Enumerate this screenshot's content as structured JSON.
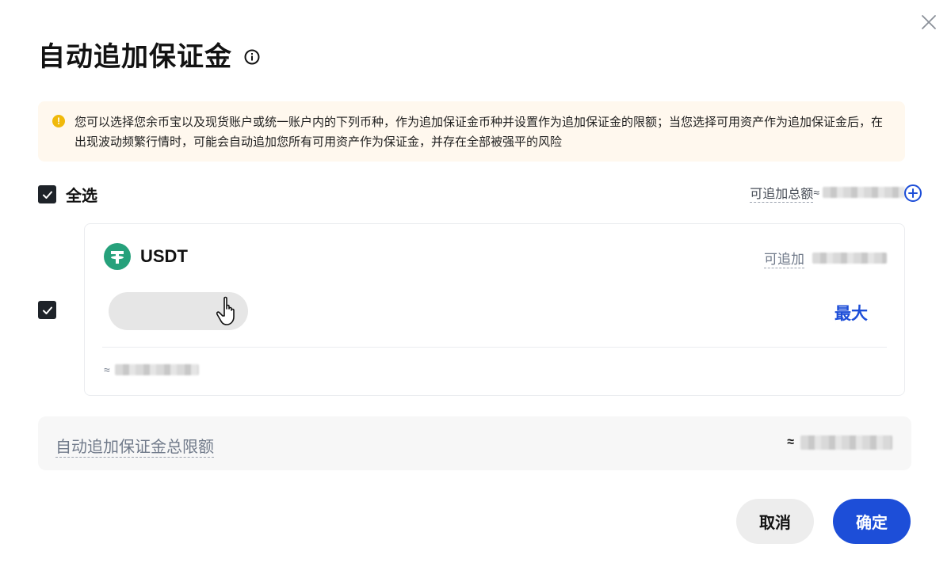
{
  "dialog": {
    "title": "自动追加保证金",
    "close_icon": "close-icon",
    "info_icon": "info-icon"
  },
  "alert": {
    "icon": "warning-icon",
    "color": "#f0b90b",
    "text": "您可以选择您余币宝以及现货账户或统一账户内的下列币种，作为追加保证金币种并设置作为追加保证金的限额；当您选择可用资产作为追加保证金后，在出现波动频繁行情时，可能会自动追加您所有可用资产作为保证金，并存在全部被强平的风险"
  },
  "select_all": {
    "label": "全选",
    "checked": true
  },
  "total_add": {
    "label": "可追加总额",
    "approx": "≈",
    "plus_icon": "plus-circle-icon"
  },
  "assets": [
    {
      "coin": "USDT",
      "checked": true,
      "available_label": "可追加",
      "max_label": "最大",
      "approx": "≈",
      "logo_color": "#26a17b"
    }
  ],
  "limit": {
    "label": "自动追加保证金总限额",
    "approx": "≈"
  },
  "buttons": {
    "cancel": "取消",
    "confirm": "确定"
  },
  "colors": {
    "accent": "#1d4ed8",
    "alert_bg": "#fff8ee"
  }
}
